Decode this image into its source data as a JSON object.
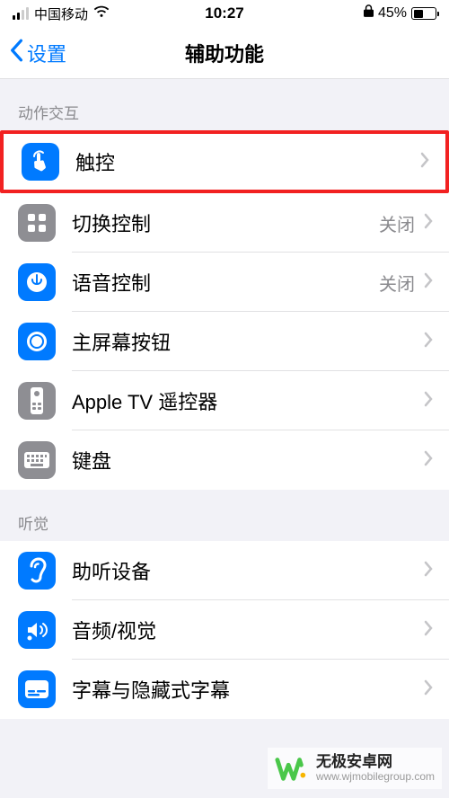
{
  "statusbar": {
    "carrier": "中国移动",
    "time": "10:27",
    "battery_pct": "45%",
    "battery_level": 0.45
  },
  "nav": {
    "back_label": "设置",
    "title": "辅助功能"
  },
  "sections": {
    "movement": {
      "header": "动作交互",
      "items": [
        {
          "label": "触控",
          "status": "",
          "icon": "touch",
          "highlighted": true
        },
        {
          "label": "切换控制",
          "status": "关闭",
          "icon": "grid"
        },
        {
          "label": "语音控制",
          "status": "关闭",
          "icon": "voice"
        },
        {
          "label": "主屏幕按钮",
          "status": "",
          "icon": "home"
        },
        {
          "label": "Apple TV 遥控器",
          "status": "",
          "icon": "remote"
        },
        {
          "label": "键盘",
          "status": "",
          "icon": "keyboard"
        }
      ]
    },
    "hearing": {
      "header": "听觉",
      "items": [
        {
          "label": "助听设备",
          "status": "",
          "icon": "ear"
        },
        {
          "label": "音频/视觉",
          "status": "",
          "icon": "audio"
        },
        {
          "label": "字幕与隐藏式字幕",
          "status": "",
          "icon": "caption"
        }
      ]
    }
  },
  "watermark": {
    "name": "无极安卓网",
    "url": "www.wjmobilegroup.com"
  }
}
